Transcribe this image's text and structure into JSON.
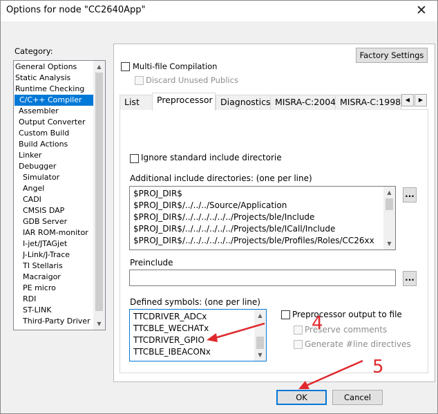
{
  "dialog": {
    "title": "Options for node \"CC2640App\"",
    "close_glyph": "✕"
  },
  "category": {
    "label": "Category:",
    "items": [
      {
        "label": "General Options",
        "indent": false,
        "selected": false
      },
      {
        "label": "Static Analysis",
        "indent": false,
        "selected": false
      },
      {
        "label": "Runtime Checking",
        "indent": false,
        "selected": false
      },
      {
        "label": "C/C++ Compiler",
        "indent": true,
        "selected": true
      },
      {
        "label": "Assembler",
        "indent": true,
        "selected": false
      },
      {
        "label": "Output Converter",
        "indent": true,
        "selected": false
      },
      {
        "label": "Custom Build",
        "indent": true,
        "selected": false
      },
      {
        "label": "Build Actions",
        "indent": true,
        "selected": false
      },
      {
        "label": "Linker",
        "indent": true,
        "selected": false
      },
      {
        "label": "Debugger",
        "indent": true,
        "selected": false
      },
      {
        "label": "Simulator",
        "indent": true,
        "selected": false,
        "deep": true
      },
      {
        "label": "Angel",
        "indent": true,
        "selected": false,
        "deep": true
      },
      {
        "label": "CADI",
        "indent": true,
        "selected": false,
        "deep": true
      },
      {
        "label": "CMSIS DAP",
        "indent": true,
        "selected": false,
        "deep": true
      },
      {
        "label": "GDB Server",
        "indent": true,
        "selected": false,
        "deep": true
      },
      {
        "label": "IAR ROM-monitor",
        "indent": true,
        "selected": false,
        "deep": true
      },
      {
        "label": "I-jet/JTAGjet",
        "indent": true,
        "selected": false,
        "deep": true
      },
      {
        "label": "J-Link/J-Trace",
        "indent": true,
        "selected": false,
        "deep": true
      },
      {
        "label": "TI Stellaris",
        "indent": true,
        "selected": false,
        "deep": true
      },
      {
        "label": "Macraigor",
        "indent": true,
        "selected": false,
        "deep": true
      },
      {
        "label": "PE micro",
        "indent": true,
        "selected": false,
        "deep": true
      },
      {
        "label": "RDI",
        "indent": true,
        "selected": false,
        "deep": true
      },
      {
        "label": "ST-LINK",
        "indent": true,
        "selected": false,
        "deep": true
      },
      {
        "label": "Third-Party Driver",
        "indent": true,
        "selected": false,
        "deep": true
      }
    ]
  },
  "factory_settings": "Factory Settings",
  "multi_file": {
    "label": "Multi-file Compilation",
    "checked": false
  },
  "discard_unused": {
    "label": "Discard Unused Publics",
    "checked": false,
    "disabled": true
  },
  "tabs": [
    {
      "label": "List",
      "active": false
    },
    {
      "label": "Preprocessor",
      "active": true
    },
    {
      "label": "Diagnostics",
      "active": false
    },
    {
      "label": "MISRA-C:2004",
      "active": false
    },
    {
      "label": "MISRA-C:1998",
      "active": false
    }
  ],
  "ignore_std": {
    "label": "Ignore standard include directories",
    "checked": false
  },
  "include_dirs": {
    "label": "Additional include directories: (one per line)",
    "lines": [
      "$PROJ_DIR$",
      "$PROJ_DIR$/../../../Source/Application",
      "$PROJ_DIR$/../../../../../../Projects/ble/Include",
      "$PROJ_DIR$/../../../../../../Projects/ble/ICall/Include",
      "$PROJ_DIR$/../../../../../../Projects/ble/Profiles/Roles/CC26xx"
    ]
  },
  "preinclude": {
    "label": "Preinclude",
    "value": ""
  },
  "defined_symbols": {
    "label": "Defined symbols: (one per line)",
    "lines": [
      "TTCDRIVER_ADCx",
      "TTCBLE_WECHATx",
      "TTCDRIVER_GPIO",
      "TTCBLE_IBEACONx"
    ]
  },
  "preproc_output": {
    "label": "Preprocessor output to file",
    "checked": false
  },
  "preserve_comments": {
    "label": "Preserve comments",
    "checked": false,
    "disabled": true
  },
  "generate_line": {
    "label": "Generate #line directives",
    "checked": false,
    "disabled": true
  },
  "browse_label": "...",
  "ok_label": "OK",
  "cancel_label": "Cancel",
  "annotations": {
    "step4": "4",
    "step5": "5",
    "color": "#e0292d"
  }
}
